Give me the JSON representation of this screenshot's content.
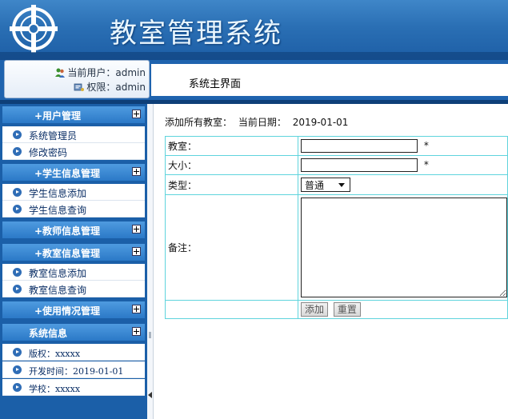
{
  "header": {
    "title": "教室管理系统",
    "logo_icon": "cross-circle-logo-icon"
  },
  "user_panel": {
    "current_user_label": "当前用户：admin",
    "role_label": "权限：admin"
  },
  "breadcrumb": "系统主界面",
  "sidebar": {
    "sections": [
      {
        "title": "+用户管理",
        "items": [
          "系统管理员",
          "修改密码"
        ]
      },
      {
        "title": "+学生信息管理",
        "items": [
          "学生信息添加",
          "学生信息查询"
        ]
      },
      {
        "title": "+教师信息管理",
        "items": []
      },
      {
        "title": "+教室信息管理",
        "items": [
          "教室信息添加",
          "教室信息查询"
        ]
      },
      {
        "title": "+使用情况管理",
        "items": []
      },
      {
        "title": "系统信息",
        "items": [
          "版权：xxxxx",
          "开发时间：2019-01-01",
          "学校：xxxxx"
        ]
      }
    ]
  },
  "page": {
    "heading": "添加所有教室：",
    "date_label": "当前日期：",
    "date_value": "2019-01-01"
  },
  "form": {
    "fields": {
      "classroom_label": "教室：",
      "size_label": "大小：",
      "type_label": "类型：",
      "note_label": "备注："
    },
    "required_mark": "*",
    "type_selected": "普通",
    "buttons": {
      "add": "添加",
      "reset": "重置"
    }
  },
  "colors": {
    "header_blue": "#2a6fb4",
    "sidebar_blue": "#1b5fa8",
    "table_border": "#5fd4dd"
  }
}
